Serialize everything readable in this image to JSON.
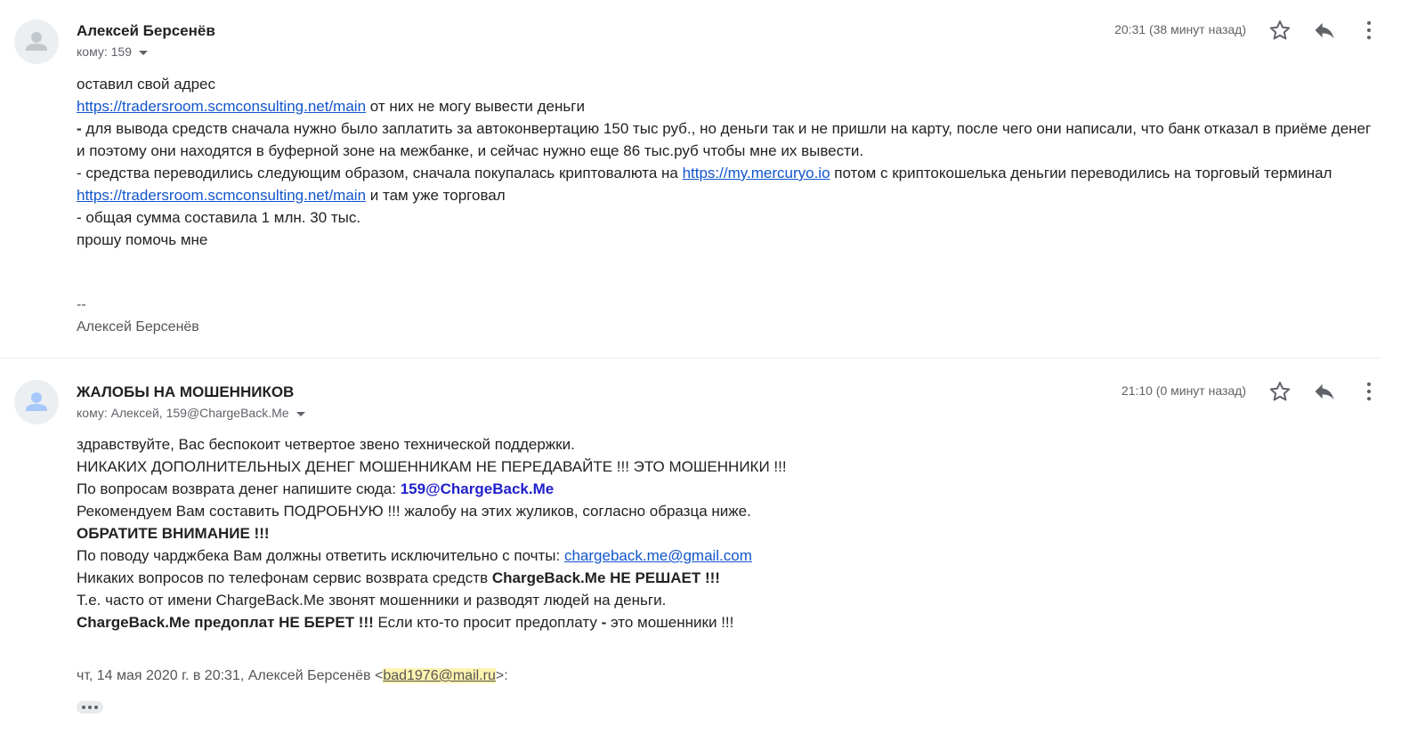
{
  "messages": [
    {
      "sender": "Алексей Берсенёв",
      "to": "кому: 159",
      "time": "20:31 (38 минут назад)",
      "body": {
        "l1": "оставил свой адрес",
        "l2_link": "https://tradersroom.scmconsulting.net/main",
        "l2_text": " от них не могу вывести деньги",
        "l3_dash": "-",
        "l3_text": " для вывода средств сначала нужно было заплатить за автоконвертацию 150 тыс руб., но деньги так и не пришли на карту, после чего они написали, что банк отказал в приёме денег и поэтому они находятся в буферной зоне на межбанке, и сейчас нужно еще 86 тыс.руб чтобы мне их вывести.",
        "l4_a": " - средства переводились следующим образом, сначала покупалась криптовалюта на ",
        "l4_link1": "https://my.mercuryo.io",
        "l4_b": " потом с криптокошелька деньгии переводились на торговый терминал ",
        "l4_link2": "https://tradersroom.scmconsulting.net/main",
        "l4_c": " и там уже торговал",
        "l5": " - общая сумма составила 1 млн. 30 тыс.",
        "l6": "прошу помочь мне",
        "sig_sep": "--",
        "sig_name": "Алексей Берсенёв"
      }
    },
    {
      "sender": "ЖАЛОБЫ НА МОШЕННИКОВ",
      "to": "кому: Алексей, 159@ChargeBack.Me",
      "time": "21:10 (0 минут назад)",
      "body": {
        "l1": "здравствуйте, Вас беспокоит четвертое звено технической поддержки.",
        "l2": "НИКАКИХ ДОПОЛНИТЕЛЬНЫХ ДЕНЕГ МОШЕННИКАМ НЕ ПЕРЕДАВАЙТЕ !!! ЭТО МОШЕННИКИ !!!",
        "l3_text": "По вопросам возврата денег напишите сюда: ",
        "l3_email": "159@ChargeBack.Me",
        "l4": "Рекомендуем Вам составить ПОДРОБНУЮ !!! жалобу на этих жуликов, согласно образца ниже.",
        "l5": "ОБРАТИТЕ ВНИМАНИЕ !!!",
        "l6_text": "По поводу чарджбека Вам должны ответить исключительно с почты: ",
        "l6_link": "chargeback.me@gmail.com",
        "l7_text": "Никаких вопросов по телефонам сервис возврата средств ",
        "l7_bold": "ChargeBack.Me НЕ РЕШАЕТ !!!",
        "l8": "Т.е. часто от имени ChargeBack.Me звонят мошенники и разводят людей на деньги.",
        "l9_bold": "ChargeBack.Me предоплат НЕ БЕРЕТ !!!",
        "l9_text": " Если кто-то просит предоплату ",
        "l9_dash": "-",
        "l9_end": " это мошенники !!!",
        "quote_prefix": "чт, 14 мая 2020 г. в 20:31, Алексей Берсенёв <",
        "quote_email": "bad1976@mail.ru",
        "quote_suffix": ">:"
      }
    }
  ],
  "icons": [
    "avatar-icon",
    "star-icon",
    "reply-icon",
    "more-vert-icon",
    "show-trimmed-icon"
  ]
}
